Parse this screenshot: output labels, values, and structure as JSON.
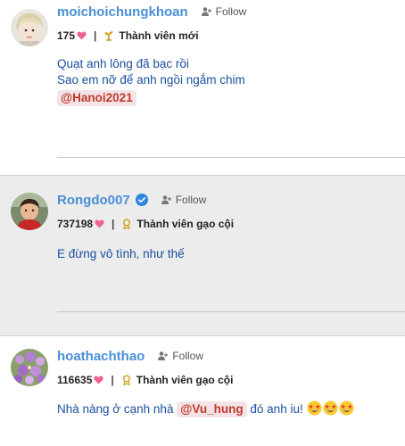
{
  "posts": [
    {
      "username": "moichoichungkhoan",
      "follow_label": "Follow",
      "likes": "175",
      "rank": "Thành viên mới",
      "content_lines": [
        "Quạt anh lông đã bạc rồi",
        "Sao em nỡ để anh ngồi ngắm chim"
      ],
      "mention": "@Hanoi2021"
    },
    {
      "username": "Rongdo007",
      "verified": true,
      "follow_label": "Follow",
      "likes": "737198",
      "rank": "Thành viên gạo cội",
      "content": "E đừng vô tình, như thế"
    },
    {
      "username": "hoathachthao",
      "follow_label": "Follow",
      "likes": "116635",
      "rank": "Thành viên gạo cội",
      "content_before": "Nhà nàng ở cạnh nhà",
      "mention": "@Vu_hung",
      "content_after": "đó anh iu!",
      "emoji": [
        "star-struck-icon",
        "star-struck-icon",
        "star-struck-icon"
      ]
    }
  ],
  "colors": {
    "username": "#4a8fd6",
    "content": "#1a4f9e",
    "mention_text": "#c0392b",
    "mention_bg": "#f3e3e6",
    "heart": "#f06292",
    "highlight_bg": "#ececec"
  }
}
